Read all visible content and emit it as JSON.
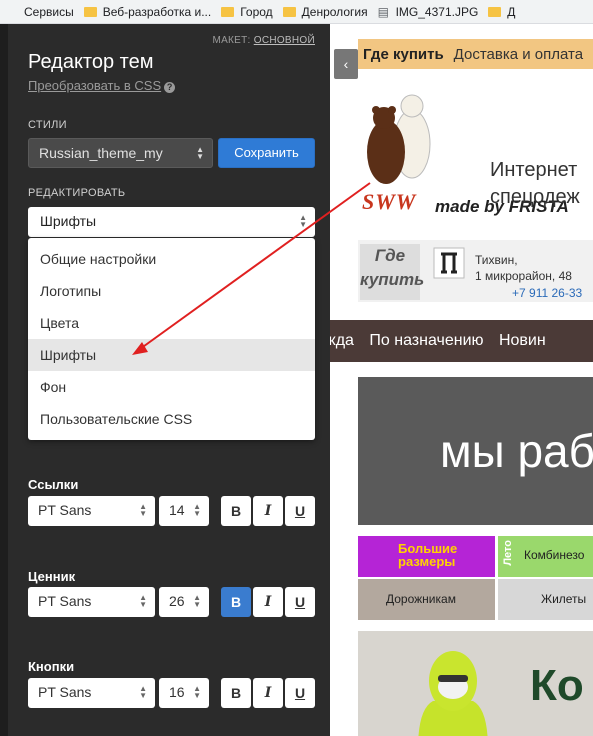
{
  "bookmarks": [
    {
      "label": "Сервисы",
      "icon": "apps-icon"
    },
    {
      "label": "Веб-разработка и...",
      "icon": "folder-icon"
    },
    {
      "label": "Город",
      "icon": "folder-icon"
    },
    {
      "label": "Денрология",
      "icon": "folder-icon"
    },
    {
      "label": "IMG_4371.JPG",
      "icon": "file-icon"
    },
    {
      "label": "Д",
      "icon": "folder-icon"
    }
  ],
  "editor": {
    "layout_label": "МАКЕТ:",
    "layout_value": "ОСНОВНОЙ",
    "title": "Редактор тем",
    "convert_link": "Преобразовать в CSS",
    "help_symbol": "?",
    "styles_label": "СТИЛИ",
    "style_value": "Russian_theme_my",
    "save_label": "Сохранить",
    "edit_label": "РЕДАКТИРОВАТЬ",
    "edit_value": "Шрифты",
    "menu": [
      {
        "label": "Общие настройки",
        "active": false
      },
      {
        "label": "Логотипы",
        "active": false
      },
      {
        "label": "Цвета",
        "active": false
      },
      {
        "label": "Шрифты",
        "active": true
      },
      {
        "label": "Фон",
        "active": false
      },
      {
        "label": "Пользовательские CSS",
        "active": false
      }
    ],
    "fonts": [
      {
        "label": "Ссылки",
        "family": "PT Sans",
        "size": "14",
        "bold": false
      },
      {
        "label": "Ценник",
        "family": "PT Sans",
        "size": "26",
        "bold": true
      },
      {
        "label": "Кнопки",
        "family": "PT Sans",
        "size": "16",
        "bold": false
      }
    ],
    "fmt_labels": {
      "b": "B",
      "i": "I",
      "u": "U"
    }
  },
  "site": {
    "collapse_symbol": "‹",
    "nav": [
      "Где купить",
      "Доставка и оплата"
    ],
    "brand": "SWW",
    "made_by": "made by FRISTA",
    "store_title_1": "Интернет",
    "store_title_2": "спецодеж",
    "where_buy_1": "Где",
    "where_buy_2": "купить",
    "address_1": "Тихвин,",
    "address_2": "1 микрорайон, 48",
    "phone": "+7 911 26-33",
    "categories": [
      "жда",
      "По назначению",
      "Новин"
    ],
    "banner_text": "мы раб",
    "tiles": {
      "big_sizes_1": "Большие",
      "big_sizes_2": "размеры",
      "summer": "Лето",
      "overalls": "Комбинезо",
      "road": "Дорожникам",
      "vests": "Жилеты"
    },
    "hero_text": "Ко"
  }
}
